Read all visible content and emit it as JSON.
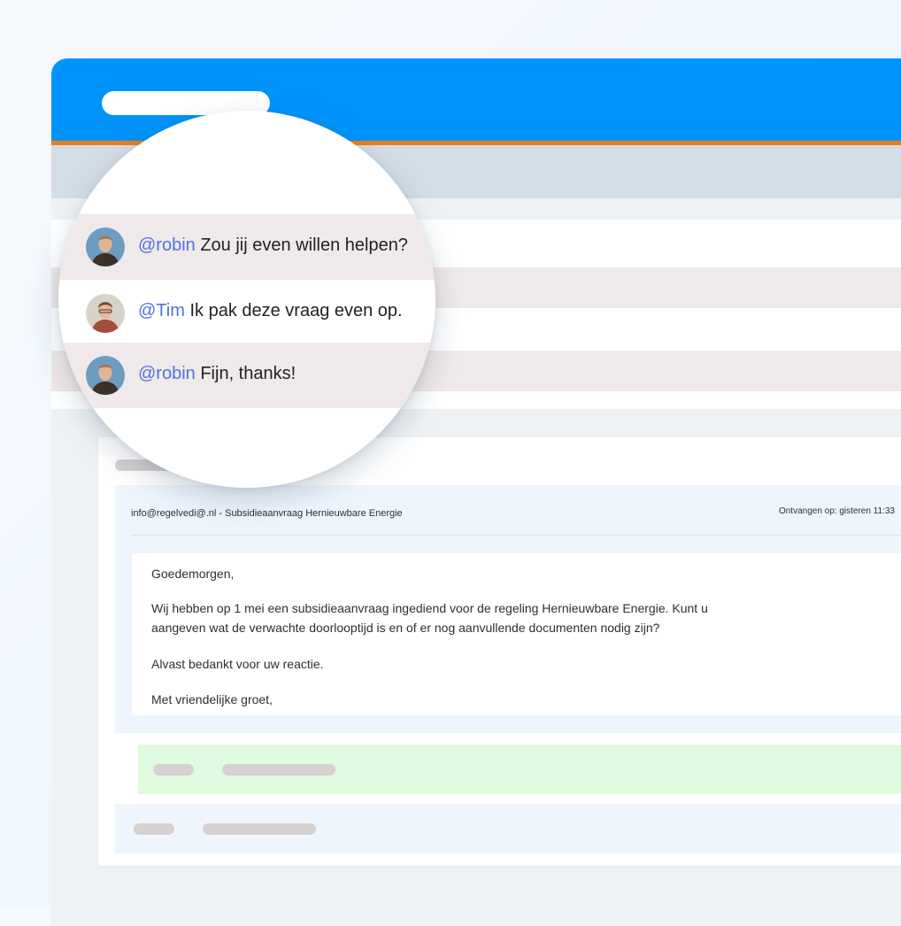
{
  "comments": [
    {
      "mention": "@robin",
      "text": "Zou jij even willen helpen?",
      "avatar": "robin-avatar"
    },
    {
      "mention": "@Tim",
      "text": "Ik pak deze vraag even op.",
      "avatar": "tim-avatar"
    },
    {
      "mention": "@robin",
      "text": "Fijn, thanks!",
      "avatar": "robin-avatar"
    }
  ],
  "email": {
    "subject": "info@regelvedi@.nl - Subsidieaanvraag Hernieuwbare Energie",
    "received": "Ontvangen op: gisteren 11:33",
    "greeting": "Goedemorgen,",
    "body_line1": "Wij hebben op 1 mei een subsidieaanvraag ingediend voor de regeling Hernieuwbare Energie. Kunt u",
    "body_line2": "aangeven wat de verwachte doorlooptijd is en of er nog aanvullende documenten nodig zijn?",
    "thanks": "Alvast bedankt voor uw reactie.",
    "closing": "Met vriendelijke groet,"
  },
  "colors": {
    "header": "#0094fa",
    "header_accent": "#ef7d19",
    "mention": "#4f72e0",
    "row_shade": "#f0e9e9",
    "mail_bg": "#eef5fd",
    "action_green": "#e0fbe0"
  }
}
